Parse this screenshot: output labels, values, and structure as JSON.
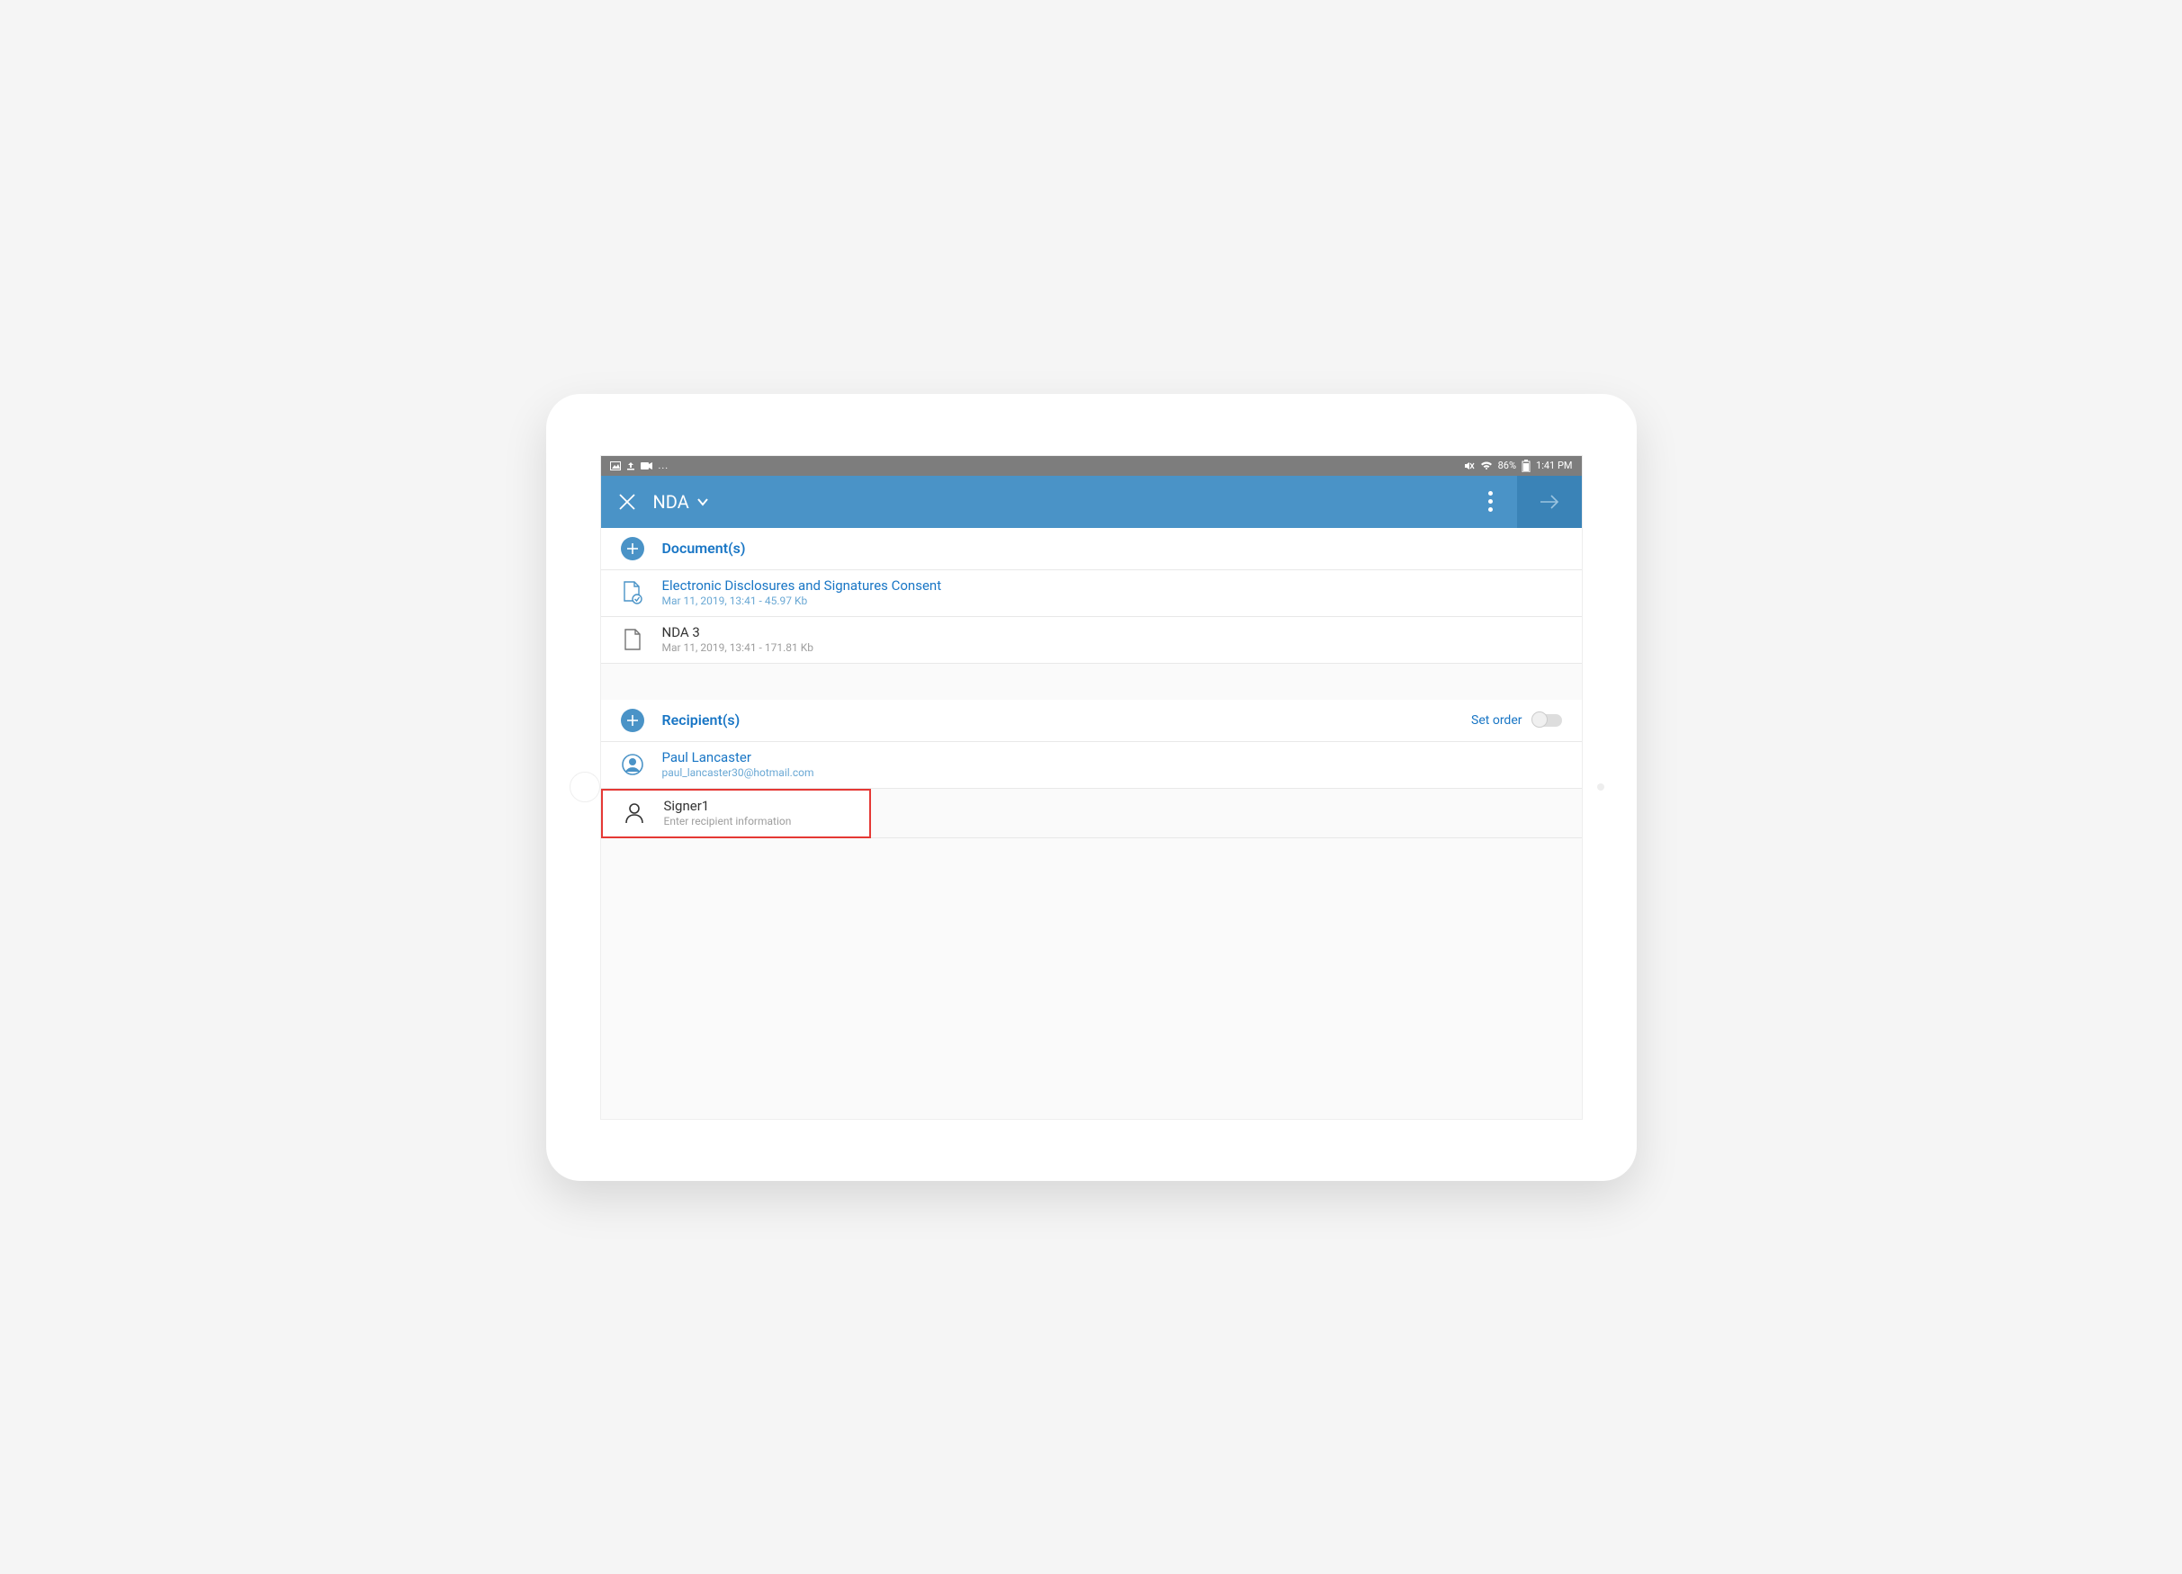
{
  "status": {
    "battery_text": "86%",
    "time": "1:41 PM"
  },
  "appbar": {
    "title": "NDA"
  },
  "sections": {
    "documents": {
      "title": "Document(s)",
      "items": [
        {
          "title": "Electronic Disclosures and Signatures Consent",
          "meta": "Mar 11, 2019, 13:41 - 45.97 Kb",
          "active": true
        },
        {
          "title": "NDA 3",
          "meta": "Mar 11, 2019, 13:41 - 171.81 Kb",
          "active": false
        }
      ]
    },
    "recipients": {
      "title": "Recipient(s)",
      "set_order_label": "Set order",
      "items": [
        {
          "title": "Paul Lancaster",
          "meta": "paul_lancaster30@hotmail.com",
          "active": true
        },
        {
          "title": "Signer1",
          "meta": "Enter recipient information",
          "active": false,
          "highlighted": true
        }
      ]
    }
  }
}
